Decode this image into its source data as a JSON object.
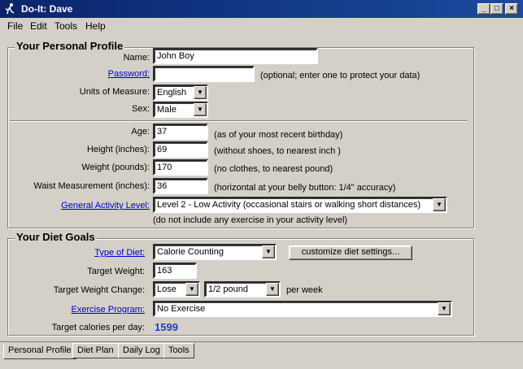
{
  "window": {
    "title": "Do-It: Dave"
  },
  "menu": [
    "File",
    "Edit",
    "Tools",
    "Help"
  ],
  "profile": {
    "section_title": "Your Personal Profile",
    "name_label": "Name:",
    "name_value": "John Boy",
    "password_label": "Password:",
    "password_value": "",
    "password_note": "(optional; enter one to protect your data)",
    "units_label": "Units of Measure:",
    "units_value": "English",
    "sex_label": "Sex:",
    "sex_value": "Male",
    "age_label": "Age:",
    "age_value": "37",
    "age_note": "(as of your most recent birthday)",
    "height_label": "Height (inches):",
    "height_value": "69",
    "height_note": "(without shoes, to nearest inch )",
    "weight_label": "Weight (pounds):",
    "weight_value": "170",
    "weight_note": "(no clothes, to nearest pound)",
    "waist_label": "Waist Measurement (inches):",
    "waist_value": "36",
    "waist_note": "(horizontal at your belly button:  1/4\" accuracy)",
    "activity_label": "General Activity Level:",
    "activity_value": "Level 2 - Low Activity (occasional stairs or walking short distances)",
    "activity_note": "(do not include any exercise in your activity level)"
  },
  "diet": {
    "section_title": "Your Diet Goals",
    "type_label": "Type of Diet:",
    "type_value": "Calorie Counting",
    "customize_button": "customize diet settings...",
    "target_weight_label": "Target Weight:",
    "target_weight_value": "163",
    "change_label": "Target Weight Change:",
    "change_direction": "Lose",
    "change_amount": "1/2 pound",
    "change_unit": "per week",
    "exercise_label": "Exercise Program:",
    "exercise_value": "No Exercise",
    "calories_label": "Target calories per day:",
    "calories_value": "1599"
  },
  "tabs": [
    "Personal Profile",
    "Diet Plan",
    "Daily Log",
    "Tools"
  ],
  "colors": {
    "titlebar": "#0a246a",
    "link": "#0000cc",
    "calories": "#1f3fbf"
  }
}
